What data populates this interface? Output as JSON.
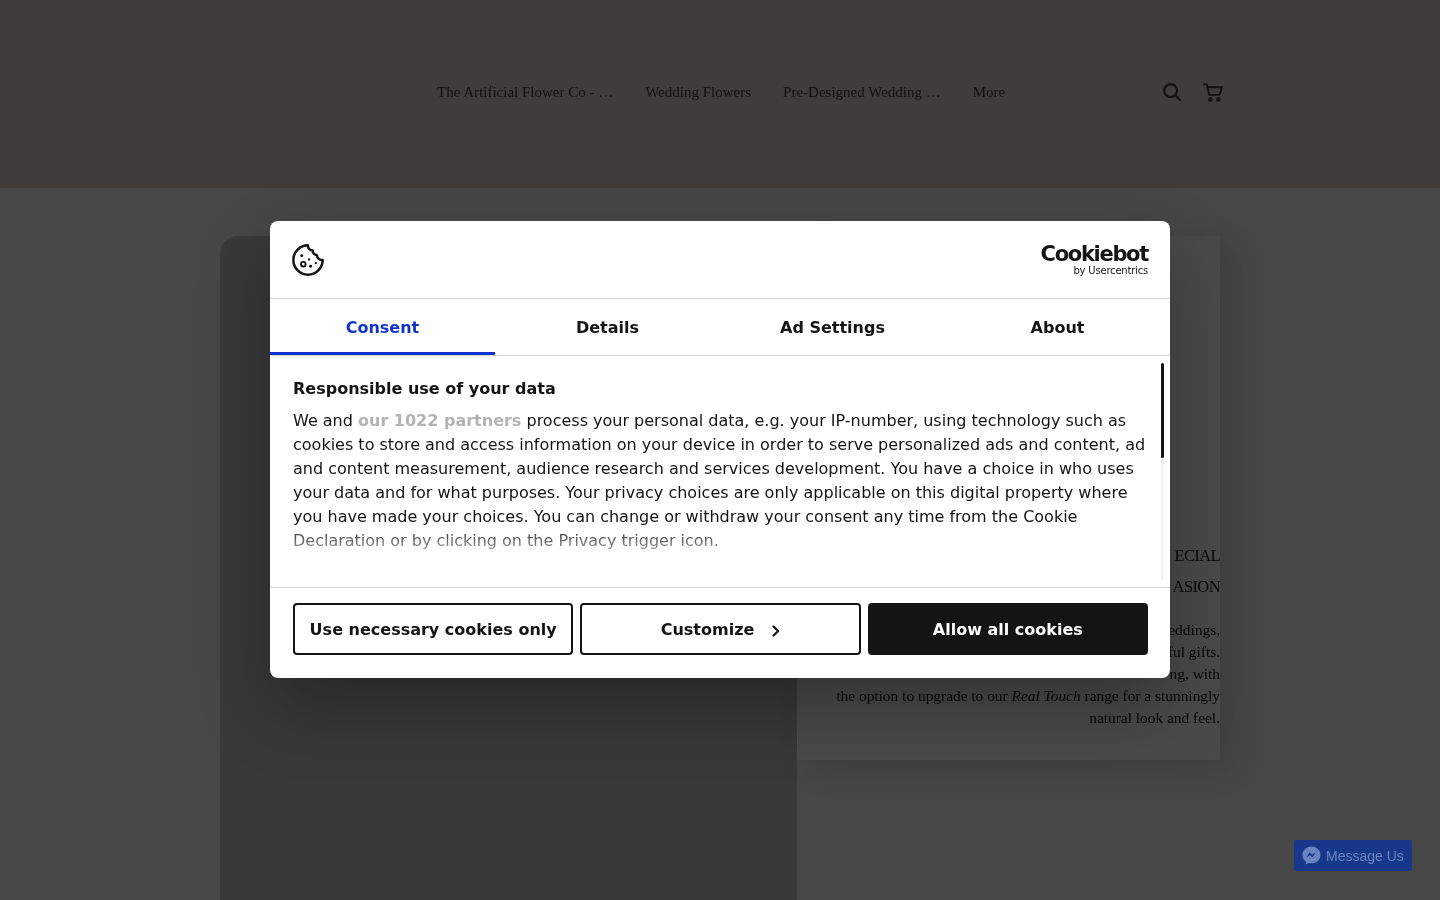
{
  "site_header": {
    "nav": [
      "The Artificial Flower Co - …",
      "Wedding Flowers",
      "Pre-Designed Wedding …",
      "More"
    ]
  },
  "hero": {
    "heading_lines": [
      "ECIAL",
      "ASION"
    ],
    "text_lines": [
      "eddings,",
      "ful gifts.",
      "ng, with",
      "the option to upgrade to our *Real Touch* range for a stunningly",
      "natural look and feel."
    ]
  },
  "chat_button": {
    "label": "Message Us"
  },
  "consent_dialog": {
    "brand": {
      "name": "Cookiebot",
      "byline": "by Usercentrics"
    },
    "tabs": [
      {
        "label": "Consent",
        "selected": true
      },
      {
        "label": "Details",
        "selected": false
      },
      {
        "label": "Ad Settings",
        "selected": false
      },
      {
        "label": "About",
        "selected": false
      }
    ],
    "heading": "Responsible use of your data",
    "body": "We and **our 1022 partners** process your personal data, e.g. your IP-number, using technology such as cookies to store and access information on your device in order to serve personalized ads and content, ad and content measurement, audience research and services development. You have a choice in who uses your data and for what purposes. Your privacy choices are only applicable on this digital property where you have made your choices. You can change or withdraw your consent any time from the Cookie Declaration or by clicking on the Privacy trigger icon.",
    "buttons": [
      {
        "label": "Use necessary cookies only",
        "kind": "outline"
      },
      {
        "label": "Customize",
        "kind": "expand"
      },
      {
        "label": "Allow all cookies",
        "kind": "filled"
      }
    ]
  }
}
